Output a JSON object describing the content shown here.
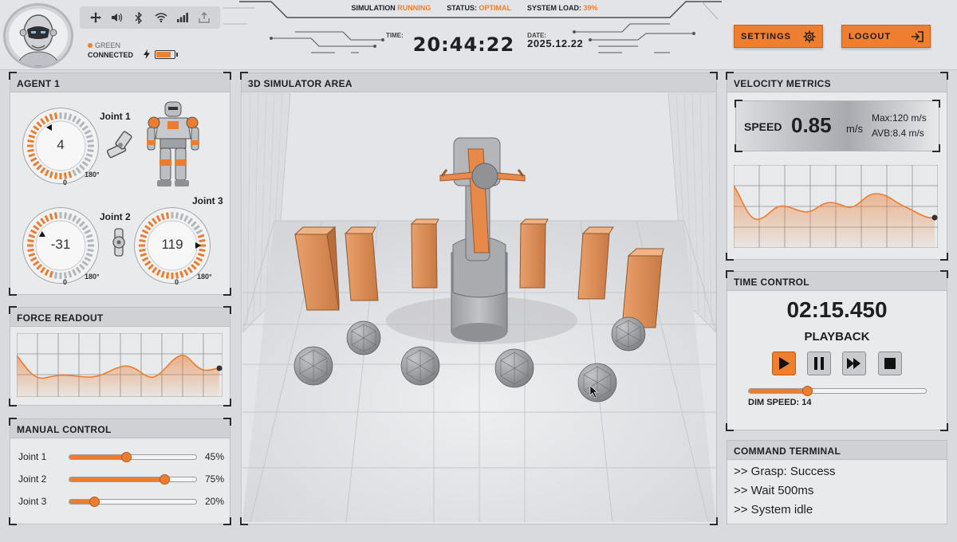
{
  "header": {
    "status_icons": [
      "move-icon",
      "volume-icon",
      "bluetooth-icon",
      "wifi-icon",
      "signal-icon",
      "upload-icon"
    ],
    "network_color_label": "GREEN",
    "network_status": "CONNECTED",
    "battery_level": 0.8,
    "sim_label": "SIMULATION",
    "sim_value": "RUNNING",
    "status_label": "STATUS:",
    "status_value": "OPTIMAL",
    "load_label": "SYSTEM LOAD:",
    "load_value": "39%",
    "time_label": "TIME:",
    "time_value": "20:44:22",
    "date_label": "DATE:",
    "date_value": "2025.12.22",
    "settings_label": "SETTINGS",
    "logout_label": "LOGOUT"
  },
  "agent": {
    "title": "AGENT 1",
    "joints": [
      {
        "label": "Joint 1",
        "value": "4",
        "min": "0",
        "max": "180°"
      },
      {
        "label": "Joint 2",
        "value": "-31",
        "min": "0",
        "max": "180°"
      },
      {
        "label": "Joint 3",
        "value": "119",
        "min": "0",
        "max": "180°"
      }
    ]
  },
  "force": {
    "title": "FORCE READOUT"
  },
  "manual": {
    "title": "MANUAL CONTROL",
    "rows": [
      {
        "label": "Joint 1",
        "pct": "45%",
        "value": 0.45
      },
      {
        "label": "Joint 2",
        "pct": "75%",
        "value": 0.75
      },
      {
        "label": "Joint 3",
        "pct": "20%",
        "value": 0.2
      }
    ]
  },
  "sim": {
    "title": "3D SIMULATOR AREA"
  },
  "velocity": {
    "title": "VELOCITY METRICS",
    "speed_label": "SPEED",
    "speed_value": "0.85",
    "speed_unit": "m/s",
    "max_label": "Max:120 m/s",
    "avg_label": "AVB:8.4 m/s"
  },
  "time_control": {
    "title": "TIME CONTROL",
    "timer": "02:15.450",
    "mode": "PLAYBACK",
    "dim_speed_label": "DIM SPEED: 14",
    "dim_speed_value": 0.33
  },
  "terminal": {
    "title": "COMMAND TERMINAL",
    "lines": [
      ">> Grasp: Success",
      ">> Wait 500ms",
      ">> System idle"
    ]
  },
  "colors": {
    "accent": "#ea7d30",
    "panel": "#e9eaec",
    "header": "#cfd1d5"
  }
}
